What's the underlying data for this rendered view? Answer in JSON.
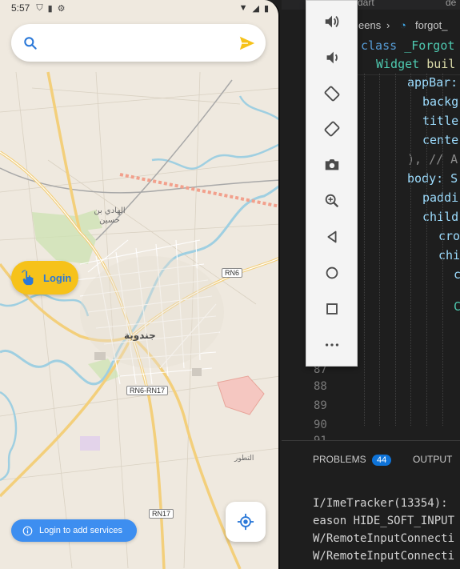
{
  "status_bar": {
    "time": "5:57"
  },
  "search": {
    "value": "",
    "placeholder": ""
  },
  "map": {
    "labels": {
      "city": "جندوبة",
      "village": "الهادي بن حسين",
      "road_rn6": "RN6",
      "road_rn6_rn17": "RN6-RN17",
      "road_rn17": "RN17",
      "area_tattour": "التطور"
    }
  },
  "login_button": {
    "label": "Login"
  },
  "services_chip": {
    "label": "Login to add services"
  },
  "editor": {
    "tabs": [
      "dart",
      "de"
    ],
    "breadcrumb": {
      "folder": "eens",
      "file": "forgot_"
    },
    "code_lines": [
      {
        "kw": "class",
        "name": "_Forgot"
      },
      {
        "kw": "Widget",
        "name": "buil"
      },
      {
        "text": "appBar:"
      },
      {
        "text": "backg"
      },
      {
        "text": "title"
      },
      {
        "text": "cente"
      },
      {
        "text": "), // A"
      },
      {
        "text": "body: S"
      },
      {
        "text": "paddi"
      },
      {
        "text": "child"
      },
      {
        "text": "cro"
      },
      {
        "text": "chi"
      },
      {
        "text": "c"
      },
      {
        "text": "C"
      }
    ],
    "line_numbers": [
      "87",
      "88",
      "89",
      "90",
      "91"
    ]
  },
  "panel": {
    "problems_label": "PROBLEMS",
    "problems_count": "44",
    "output_label": "OUTPUT",
    "output_lines": [
      "I/ImeTracker(13354):",
      "eason HIDE_SOFT_INPUT",
      "W/RemoteInputConnecti",
      "W/RemoteInputConnecti"
    ]
  },
  "emulator_toolbar": {
    "buttons": [
      "volume-up",
      "volume-down",
      "rotate-left",
      "rotate-right",
      "screenshot",
      "zoom",
      "back",
      "home",
      "overview",
      "more"
    ]
  },
  "colors": {
    "login_button_bg": "#f6c21a",
    "login_text": "#2a78d8",
    "services_chip_bg": "#3d8ef0",
    "search_send_icon": "#f6c21a",
    "search_icon": "#2a78d8",
    "locate_icon": "#2a78d8",
    "problems_badge": "#0e73d8"
  }
}
